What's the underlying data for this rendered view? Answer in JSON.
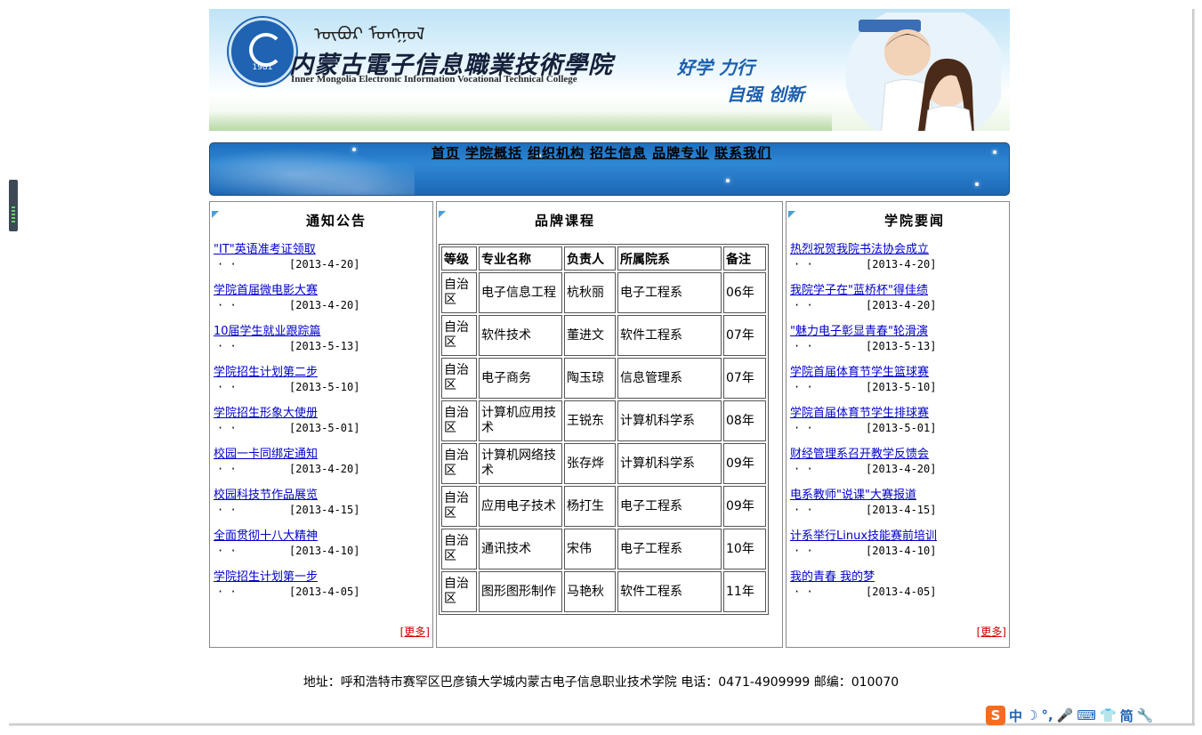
{
  "header": {
    "mongolian_script": "ᠥᠪᠦᠷ ᠮᠣᠩᠭᠣᠯ",
    "school_name_cn": "内蒙古電子信息職業技術學院",
    "school_name_en": "Inner Mongolia Electronic Information Vocational Technical College",
    "logo_year": "1981",
    "slogan_line1": "好学 力行",
    "slogan_line2": "自强 创新"
  },
  "nav": {
    "items": [
      "首页",
      "学院概括",
      "组织机构",
      "招生信息",
      "品牌专业",
      "联系我们"
    ]
  },
  "notice_panel": {
    "title": "通知公告",
    "items": [
      {
        "title": "\"IT\"英语准考证领取",
        "date": "[2013-4-20]"
      },
      {
        "title": "学院首届微电影大赛",
        "date": "[2013-4-20]"
      },
      {
        "title": "10届学生就业跟踪篇",
        "date": "[2013-5-13]"
      },
      {
        "title": "学院招生计划第二步",
        "date": "[2013-5-10]"
      },
      {
        "title": "学院招生形象大使册",
        "date": "[2013-5-01]"
      },
      {
        "title": "校园一卡同绑定通知",
        "date": "[2013-4-20]"
      },
      {
        "title": "校园科技节作品展览",
        "date": "[2013-4-15]"
      },
      {
        "title": "全面贯彻十八大精神",
        "date": "[2013-4-10]"
      },
      {
        "title": "学院招生计划第一步",
        "date": "[2013-4-05]"
      }
    ],
    "more": "[更多]"
  },
  "courses_panel": {
    "title": "品牌课程",
    "headers": [
      "等级",
      "专业名称",
      "负责人",
      "所属院系",
      "备注"
    ],
    "rows": [
      [
        "自治区",
        "电子信息工程",
        "杭秋丽",
        "电子工程系",
        "06年"
      ],
      [
        "自治区",
        "软件技术",
        "董进文",
        "软件工程系",
        "07年"
      ],
      [
        "自治区",
        "电子商务",
        "陶玉琼",
        "信息管理系",
        "07年"
      ],
      [
        "自治区",
        "计算机应用技术",
        "王锐东",
        "计算机科学系",
        "08年"
      ],
      [
        "自治区",
        "计算机网络技术",
        "张存烨",
        "计算机科学系",
        "09年"
      ],
      [
        "自治区",
        "应用电子技术",
        "杨打生",
        "电子工程系",
        "09年"
      ],
      [
        "自治区",
        "通讯技术",
        "宋伟",
        "电子工程系",
        "10年"
      ],
      [
        "自治区",
        "图形图形制作",
        "马艳秋",
        "软件工程系",
        "11年"
      ]
    ]
  },
  "news_panel": {
    "title": "学院要闻",
    "items": [
      {
        "title": "热烈祝贺我院书法协会成立",
        "date": "[2013-4-20]"
      },
      {
        "title": "我院学子在\"蓝桥杯\"得佳绩",
        "date": "[2013-4-20]"
      },
      {
        "title": "\"魅力电子彰显青春\"轮滑演",
        "date": "[2013-5-13]"
      },
      {
        "title": "学院首届体育节学生篮球赛",
        "date": "[2013-5-10]"
      },
      {
        "title": "学院首届体育节学生排球赛",
        "date": "[2013-5-01]"
      },
      {
        "title": "财经管理系召开教学反馈会",
        "date": "[2013-4-20]"
      },
      {
        "title": "电系教师\"说课\"大赛报道",
        "date": "[2013-4-15]"
      },
      {
        "title": "计系举行Linux技能赛前培训",
        "date": "[2013-4-10]"
      },
      {
        "title": "我的青春 我的梦",
        "date": "[2013-4-05]"
      }
    ],
    "more": "[更多]"
  },
  "footer": {
    "text": "地址：呼和浩特市赛罕区巴彦镇大学城内蒙古电子信息职业技术学院 电话：0471-4909999  邮编：010070"
  },
  "ime_bar": {
    "logo": "S",
    "items": [
      "中",
      "☽",
      "°,",
      "🎤",
      "⌨",
      "👕",
      "简",
      "🔧"
    ]
  },
  "colors": {
    "link": "#0000cc",
    "more": "#cc0000",
    "nav_bg": "#2f87d3"
  }
}
